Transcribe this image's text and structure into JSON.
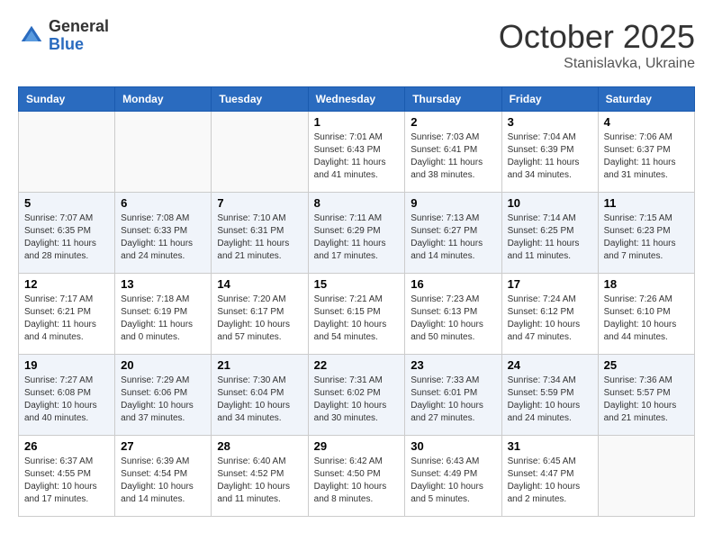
{
  "header": {
    "logo_general": "General",
    "logo_blue": "Blue",
    "month_year": "October 2025",
    "location": "Stanislavka, Ukraine"
  },
  "days_of_week": [
    "Sunday",
    "Monday",
    "Tuesday",
    "Wednesday",
    "Thursday",
    "Friday",
    "Saturday"
  ],
  "weeks": [
    [
      {
        "day": "",
        "content": ""
      },
      {
        "day": "",
        "content": ""
      },
      {
        "day": "",
        "content": ""
      },
      {
        "day": "1",
        "content": "Sunrise: 7:01 AM\nSunset: 6:43 PM\nDaylight: 11 hours and 41 minutes."
      },
      {
        "day": "2",
        "content": "Sunrise: 7:03 AM\nSunset: 6:41 PM\nDaylight: 11 hours and 38 minutes."
      },
      {
        "day": "3",
        "content": "Sunrise: 7:04 AM\nSunset: 6:39 PM\nDaylight: 11 hours and 34 minutes."
      },
      {
        "day": "4",
        "content": "Sunrise: 7:06 AM\nSunset: 6:37 PM\nDaylight: 11 hours and 31 minutes."
      }
    ],
    [
      {
        "day": "5",
        "content": "Sunrise: 7:07 AM\nSunset: 6:35 PM\nDaylight: 11 hours and 28 minutes."
      },
      {
        "day": "6",
        "content": "Sunrise: 7:08 AM\nSunset: 6:33 PM\nDaylight: 11 hours and 24 minutes."
      },
      {
        "day": "7",
        "content": "Sunrise: 7:10 AM\nSunset: 6:31 PM\nDaylight: 11 hours and 21 minutes."
      },
      {
        "day": "8",
        "content": "Sunrise: 7:11 AM\nSunset: 6:29 PM\nDaylight: 11 hours and 17 minutes."
      },
      {
        "day": "9",
        "content": "Sunrise: 7:13 AM\nSunset: 6:27 PM\nDaylight: 11 hours and 14 minutes."
      },
      {
        "day": "10",
        "content": "Sunrise: 7:14 AM\nSunset: 6:25 PM\nDaylight: 11 hours and 11 minutes."
      },
      {
        "day": "11",
        "content": "Sunrise: 7:15 AM\nSunset: 6:23 PM\nDaylight: 11 hours and 7 minutes."
      }
    ],
    [
      {
        "day": "12",
        "content": "Sunrise: 7:17 AM\nSunset: 6:21 PM\nDaylight: 11 hours and 4 minutes."
      },
      {
        "day": "13",
        "content": "Sunrise: 7:18 AM\nSunset: 6:19 PM\nDaylight: 11 hours and 0 minutes."
      },
      {
        "day": "14",
        "content": "Sunrise: 7:20 AM\nSunset: 6:17 PM\nDaylight: 10 hours and 57 minutes."
      },
      {
        "day": "15",
        "content": "Sunrise: 7:21 AM\nSunset: 6:15 PM\nDaylight: 10 hours and 54 minutes."
      },
      {
        "day": "16",
        "content": "Sunrise: 7:23 AM\nSunset: 6:13 PM\nDaylight: 10 hours and 50 minutes."
      },
      {
        "day": "17",
        "content": "Sunrise: 7:24 AM\nSunset: 6:12 PM\nDaylight: 10 hours and 47 minutes."
      },
      {
        "day": "18",
        "content": "Sunrise: 7:26 AM\nSunset: 6:10 PM\nDaylight: 10 hours and 44 minutes."
      }
    ],
    [
      {
        "day": "19",
        "content": "Sunrise: 7:27 AM\nSunset: 6:08 PM\nDaylight: 10 hours and 40 minutes."
      },
      {
        "day": "20",
        "content": "Sunrise: 7:29 AM\nSunset: 6:06 PM\nDaylight: 10 hours and 37 minutes."
      },
      {
        "day": "21",
        "content": "Sunrise: 7:30 AM\nSunset: 6:04 PM\nDaylight: 10 hours and 34 minutes."
      },
      {
        "day": "22",
        "content": "Sunrise: 7:31 AM\nSunset: 6:02 PM\nDaylight: 10 hours and 30 minutes."
      },
      {
        "day": "23",
        "content": "Sunrise: 7:33 AM\nSunset: 6:01 PM\nDaylight: 10 hours and 27 minutes."
      },
      {
        "day": "24",
        "content": "Sunrise: 7:34 AM\nSunset: 5:59 PM\nDaylight: 10 hours and 24 minutes."
      },
      {
        "day": "25",
        "content": "Sunrise: 7:36 AM\nSunset: 5:57 PM\nDaylight: 10 hours and 21 minutes."
      }
    ],
    [
      {
        "day": "26",
        "content": "Sunrise: 6:37 AM\nSunset: 4:55 PM\nDaylight: 10 hours and 17 minutes."
      },
      {
        "day": "27",
        "content": "Sunrise: 6:39 AM\nSunset: 4:54 PM\nDaylight: 10 hours and 14 minutes."
      },
      {
        "day": "28",
        "content": "Sunrise: 6:40 AM\nSunset: 4:52 PM\nDaylight: 10 hours and 11 minutes."
      },
      {
        "day": "29",
        "content": "Sunrise: 6:42 AM\nSunset: 4:50 PM\nDaylight: 10 hours and 8 minutes."
      },
      {
        "day": "30",
        "content": "Sunrise: 6:43 AM\nSunset: 4:49 PM\nDaylight: 10 hours and 5 minutes."
      },
      {
        "day": "31",
        "content": "Sunrise: 6:45 AM\nSunset: 4:47 PM\nDaylight: 10 hours and 2 minutes."
      },
      {
        "day": "",
        "content": ""
      }
    ]
  ]
}
